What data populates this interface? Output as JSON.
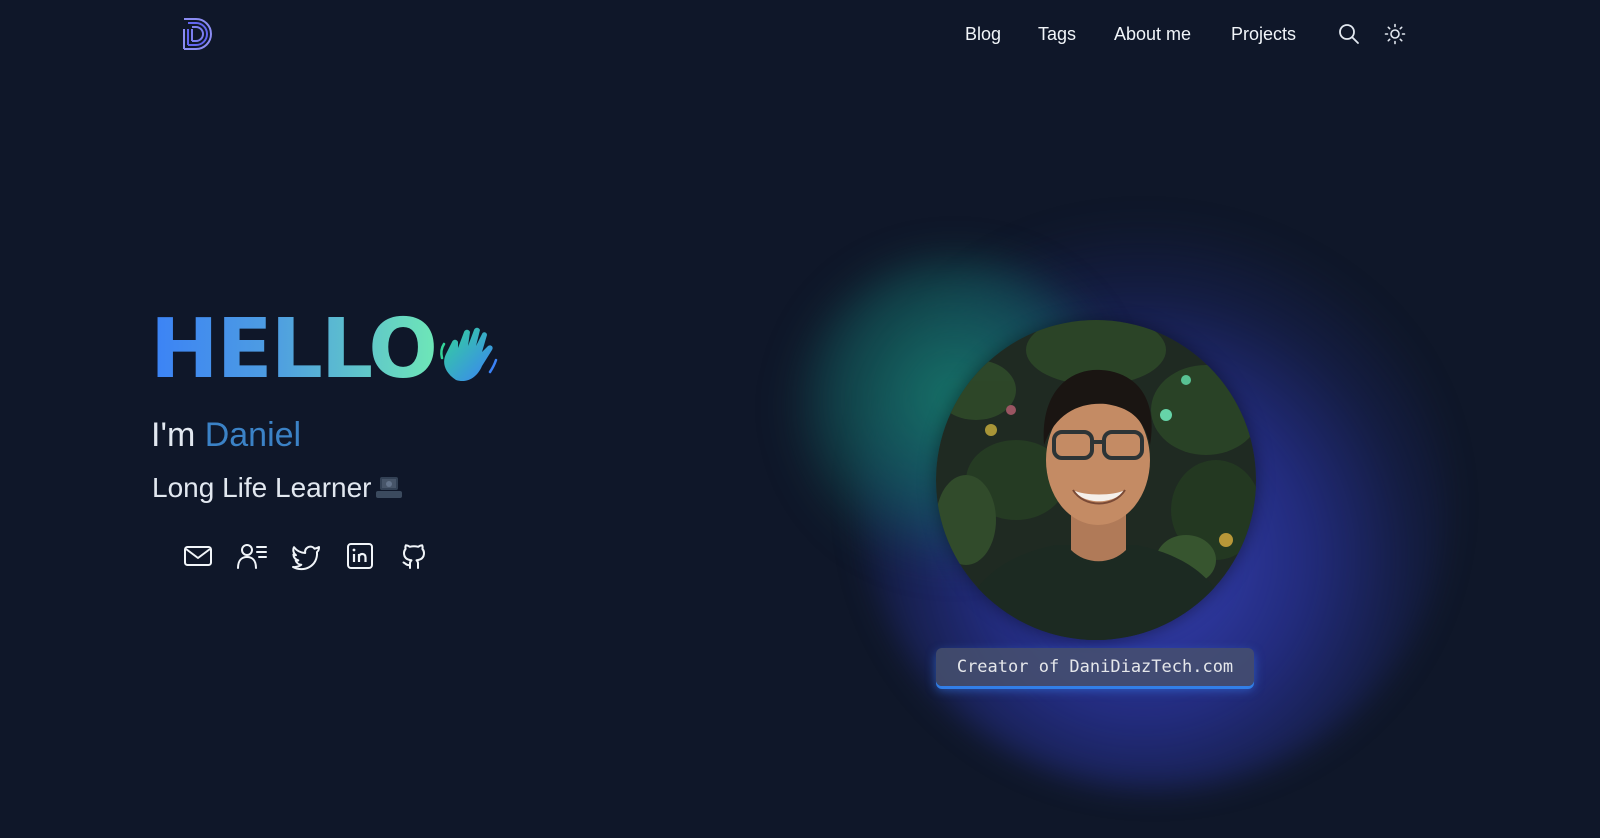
{
  "header": {
    "logo_name": "site-logo",
    "nav": [
      {
        "label": "Blog"
      },
      {
        "label": "Tags"
      },
      {
        "label": "About me"
      },
      {
        "label": "Projects"
      }
    ],
    "search_icon": "search-icon",
    "theme_icon": "sun-icon"
  },
  "hero": {
    "greeting": "HELLO",
    "greeting_emoji": "waving-hand",
    "intro_prefix": "I'm",
    "name": "Daniel",
    "tagline": "Long Life Learner",
    "tagline_emoji": "laptop-technologist",
    "socials": [
      {
        "icon": "mail-icon"
      },
      {
        "icon": "resume-icon"
      },
      {
        "icon": "twitter-icon"
      },
      {
        "icon": "linkedin-icon"
      },
      {
        "icon": "github-icon"
      }
    ]
  },
  "profile": {
    "caption": "Creator of DaniDiazTech.com"
  },
  "colors": {
    "background": "#0f1729",
    "accent_blue": "#3b82f6",
    "accent_green": "#6ee7b7",
    "name_color": "#3b82c6"
  }
}
